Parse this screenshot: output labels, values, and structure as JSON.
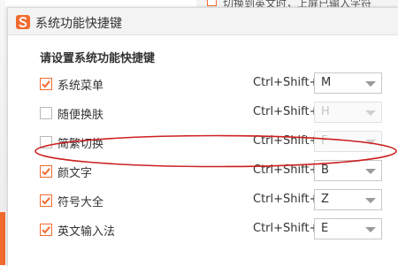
{
  "background": {
    "partial_text": "切换到英文时，上屏已输入字符"
  },
  "dialog": {
    "title": "系统功能快捷键",
    "section_label": "请设置系统功能快捷键",
    "rows": [
      {
        "label": "系统菜单",
        "checked": true,
        "modifier": "Ctrl+Shift+",
        "key": "M",
        "enabled": true
      },
      {
        "label": "随便换肤",
        "checked": false,
        "modifier": "Ctrl+Shift+",
        "key": "H",
        "enabled": false
      },
      {
        "label": "简繁切换",
        "checked": false,
        "modifier": "Ctrl+Shift+",
        "key": "F",
        "enabled": false
      },
      {
        "label": "颜文字",
        "checked": true,
        "modifier": "Ctrl+Shift+",
        "key": "B",
        "enabled": true
      },
      {
        "label": "符号大全",
        "checked": true,
        "modifier": "Ctrl+Shift+",
        "key": "Z",
        "enabled": true
      },
      {
        "label": "英文输入法",
        "checked": true,
        "modifier": "Ctrl+Shift+",
        "key": "E",
        "enabled": true
      }
    ]
  },
  "colors": {
    "accent": "#f26a2e",
    "annotation": "#cc1f1f"
  },
  "icons": {
    "logo": "sogou-s-logo-icon",
    "check": "checkmark-icon",
    "dropdown": "chevron-down-icon"
  }
}
